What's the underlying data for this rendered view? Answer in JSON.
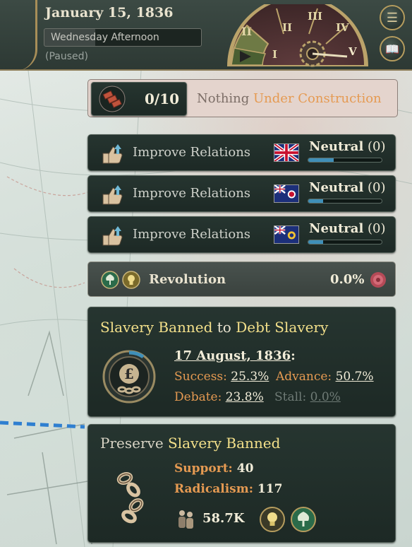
{
  "header": {
    "date": "January 15, 1836",
    "day_time": "Wednesday Afternoon",
    "day_progress": 0.32,
    "status": "(Paused)",
    "speeds": [
      "I",
      "II",
      "III",
      "IV",
      "V"
    ],
    "pause_symbol": "II",
    "menu_icon": "hamburger-menu-icon",
    "ledger_icon": "open-book-icon"
  },
  "construction": {
    "count": "0/10",
    "text_prefix": "Nothing ",
    "text_highlight": "Under Construction",
    "icon": "bricks-icon"
  },
  "relations": [
    {
      "label": "Improve Relations",
      "status": "Neutral",
      "value": "(0)",
      "flag": "union-jack-flag",
      "progress": 0.35
    },
    {
      "label": "Improve Relations",
      "status": "Neutral",
      "value": "(0)",
      "flag": "blue-ensign-red-badge-flag",
      "progress": 0.2
    },
    {
      "label": "Improve Relations",
      "status": "Neutral",
      "value": "(0)",
      "flag": "blue-ensign-yellow-badge-flag",
      "progress": 0.2
    }
  ],
  "revolution": {
    "label": "Revolution",
    "value": "0.0%",
    "icons": [
      "tree-icon",
      "lightbulb-icon",
      "rose-icon"
    ]
  },
  "law": {
    "current": "Slavery Banned",
    "to": " to ",
    "target": "Debt Slavery",
    "date": "17 August, 1836",
    "colon": ":",
    "success_label": "Success: ",
    "success_value": "25.3%",
    "advance_label": "Advance: ",
    "advance_value": "50.7%",
    "debate_label": "Debate: ",
    "debate_value": "23.8%",
    "stall_label": "Stall: ",
    "stall_value": "0.0%",
    "icon": "pound-chain-icon"
  },
  "movement": {
    "title_prefix": "Preserve ",
    "title_highlight": "Slavery Banned",
    "support_label": "Support: ",
    "support_value": "40",
    "radicalism_label": "Radicalism: ",
    "radicalism_value": "117",
    "population": "58.7K",
    "icons": [
      "broken-chain-icon",
      "people-icon",
      "lightbulb-icon",
      "tree-icon"
    ]
  },
  "colors": {
    "accent_gold": "#b59c5e",
    "highlight_yellow": "#f3e08a",
    "label_orange": "#e59a52",
    "panel_dark": "#1d2925",
    "bar_blue": "#3f8fb8"
  }
}
